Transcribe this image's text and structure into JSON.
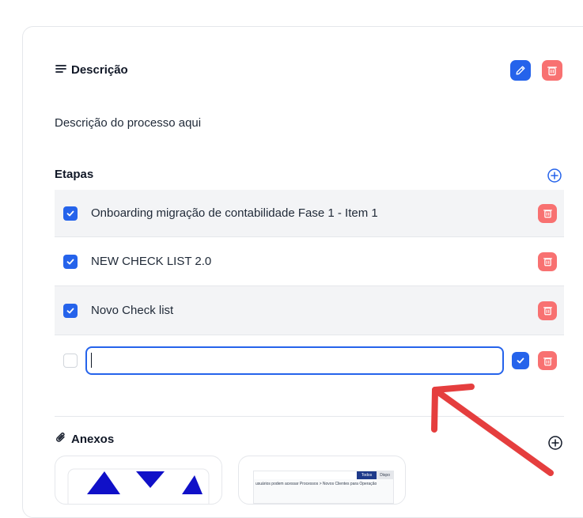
{
  "description": {
    "title": "Descrição",
    "text": "Descrição do processo aqui"
  },
  "steps": {
    "title": "Etapas",
    "items": [
      {
        "label": "Onboarding migração de contabilidade Fase 1 - Item 1",
        "checked": true
      },
      {
        "label": "NEW CHECK LIST 2.0",
        "checked": true
      },
      {
        "label": "Novo Check list",
        "checked": true
      }
    ],
    "new_item_value": ""
  },
  "attachments": {
    "title": "Anexos",
    "doc_preview": {
      "tab_active": "Todos",
      "tab_other": "Dispo",
      "line": "usuários podem acessar Processos > Novos Clientes para Operação"
    }
  },
  "colors": {
    "accent": "#2563eb",
    "danger": "#f87171",
    "arrow": "#e53e3e"
  }
}
